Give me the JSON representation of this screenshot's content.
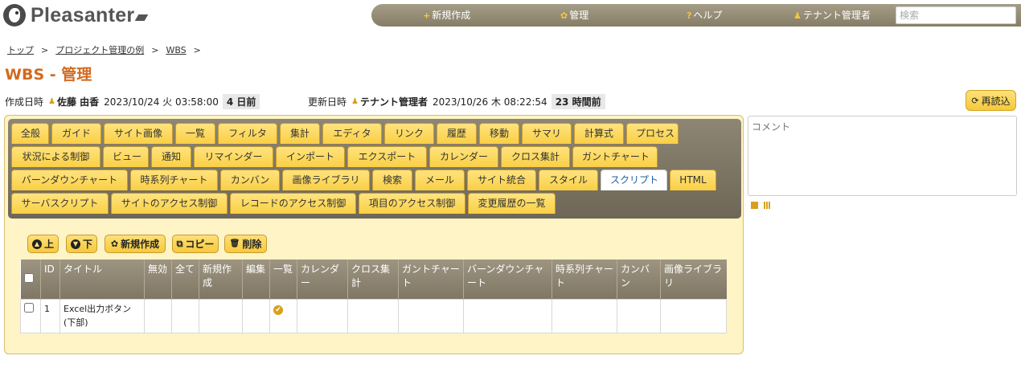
{
  "header": {
    "logo_text": "Pleasanter",
    "nav": [
      {
        "icon": "+",
        "label": "新規作成"
      },
      {
        "icon": "✿",
        "label": "管理"
      },
      {
        "icon": "?",
        "label": "ヘルプ"
      },
      {
        "icon": "♟",
        "label": "テナント管理者"
      }
    ],
    "search_placeholder": "検索"
  },
  "breadcrumb": [
    "トップ",
    "プロジェクト管理の例",
    "WBS"
  ],
  "breadcrumb_sep": ">",
  "page_title": "WBS - 管理",
  "meta": {
    "created_label": "作成日時",
    "created_by": "佐藤 由香",
    "created_at": "2023/10/24 火 03:58:00",
    "created_rel": "4 日前",
    "updated_label": "更新日時",
    "updated_by": "テナント管理者",
    "updated_at": "2023/10/26 木 08:22:54",
    "updated_rel": "23 時間前"
  },
  "reload_label": "再読込",
  "tabs": [
    [
      "全般",
      "ガイド",
      "サイト画像",
      "一覧",
      "フィルタ",
      "集計",
      "エディタ",
      "リンク",
      "履歴",
      "移動",
      "サマリ",
      "計算式",
      "プロセス"
    ],
    [
      "状況による制御",
      "ビュー",
      "通知",
      "リマインダー",
      "インポート",
      "エクスポート",
      "カレンダー",
      "クロス集計",
      "ガントチャート"
    ],
    [
      "バーンダウンチャート",
      "時系列チャート",
      "カンバン",
      "画像ライブラリ",
      "検索",
      "メール",
      "サイト統合",
      "スタイル",
      "スクリプト",
      "HTML"
    ],
    [
      "サーバスクリプト",
      "サイトのアクセス制御",
      "レコードのアクセス制御",
      "項目のアクセス制御",
      "変更履歴の一覧"
    ]
  ],
  "active_tab": "スクリプト",
  "buttons": {
    "up": "上",
    "down": "下",
    "new": "新規作成",
    "copy": "コピー",
    "delete": "削除"
  },
  "table": {
    "headers": [
      "ID",
      "タイトル",
      "無効",
      "全て",
      "新規作成",
      "編集",
      "一覧",
      "カレンダー",
      "クロス集計",
      "ガントチャート",
      "バーンダウンチャート",
      "時系列チャート",
      "カンバン",
      "画像ライブラリ"
    ],
    "rows": [
      {
        "id": "1",
        "title": "Excel出力ボタン(下部)",
        "checked_columns": [
          "一覧"
        ]
      }
    ]
  },
  "comment_placeholder": "コメント"
}
